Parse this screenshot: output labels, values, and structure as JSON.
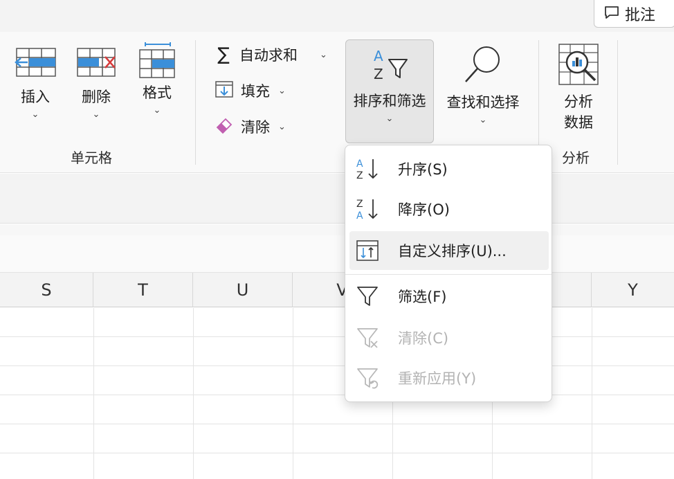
{
  "comment_button": {
    "label": "批注",
    "icon": "comment-icon"
  },
  "ribbon": {
    "cells_group": {
      "label": "单元格",
      "buttons": [
        {
          "label": "插入",
          "icon": "insert-cells-icon"
        },
        {
          "label": "删除",
          "icon": "delete-cells-icon"
        },
        {
          "label": "格式",
          "icon": "format-cells-icon"
        }
      ]
    },
    "editing_group": {
      "autosum": "自动求和",
      "fill": "填充",
      "clear": "清除",
      "sort_filter": "排序和筛选",
      "find_select": "查找和选择"
    },
    "analysis_group": {
      "label": "分析",
      "analyze_line1": "分析",
      "analyze_line2": "数据"
    }
  },
  "columns": [
    "S",
    "T",
    "U",
    "V",
    "",
    "",
    "Y"
  ],
  "sort_menu": {
    "items": [
      {
        "label": "升序(S)",
        "icon": "sort-ascending-icon",
        "enabled": true
      },
      {
        "label": "降序(O)",
        "icon": "sort-descending-icon",
        "enabled": true
      },
      {
        "label": "自定义排序(U)...",
        "icon": "custom-sort-icon",
        "enabled": true,
        "hovered": true
      },
      {
        "label": "筛选(F)",
        "icon": "filter-icon",
        "enabled": true
      },
      {
        "label": "清除(C)",
        "icon": "clear-filter-icon",
        "enabled": false
      },
      {
        "label": "重新应用(Y)",
        "icon": "reapply-filter-icon",
        "enabled": false
      }
    ]
  },
  "colors": {
    "accent_blue": "#3b8fd9",
    "delete_red": "#d83b3b",
    "eraser_pink": "#c05fb0"
  }
}
